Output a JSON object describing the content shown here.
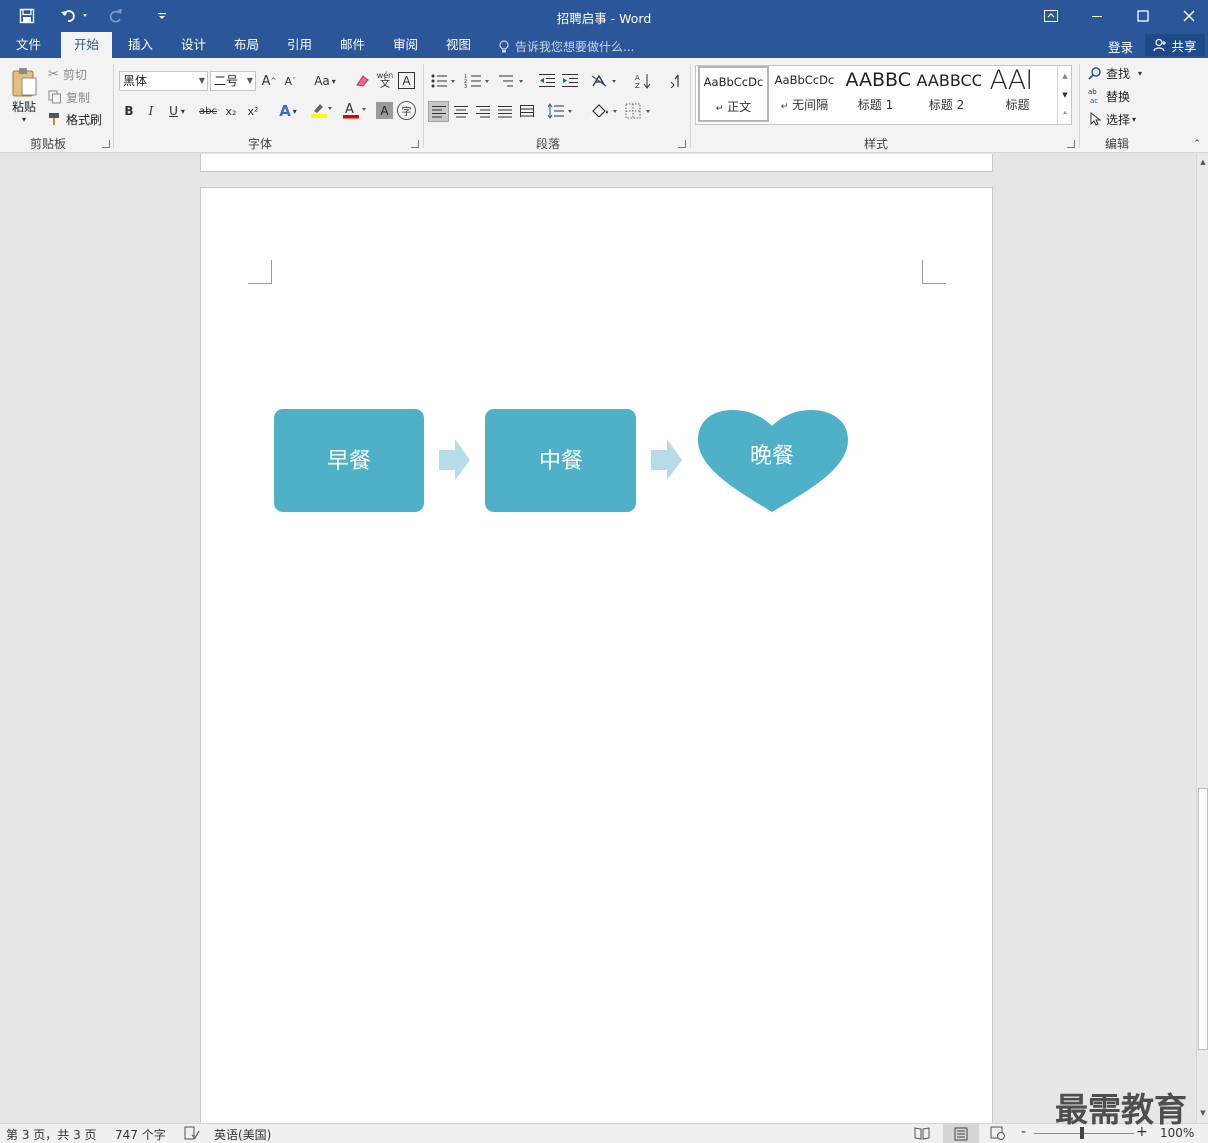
{
  "app": {
    "title": "招聘启事 - Word"
  },
  "tabs": [
    {
      "label": "文件"
    },
    {
      "label": "开始"
    },
    {
      "label": "插入"
    },
    {
      "label": "设计"
    },
    {
      "label": "布局"
    },
    {
      "label": "引用"
    },
    {
      "label": "邮件"
    },
    {
      "label": "审阅"
    },
    {
      "label": "视图"
    }
  ],
  "tell_me": {
    "placeholder": "告诉我您想要做什么..."
  },
  "account": {
    "login": "登录",
    "share": "共享"
  },
  "ribbon": {
    "clipboard": {
      "paste": "粘贴",
      "cut": "剪切",
      "copy": "复制",
      "format_painter": "格式刷",
      "label": "剪贴板"
    },
    "font": {
      "name": "黑体",
      "size": "二号",
      "grow": "A",
      "shrink": "A",
      "change_case": "Aa",
      "wen": "wén",
      "bold": "B",
      "italic": "I",
      "underline": "U",
      "strike": "abc",
      "subscript": "x₂",
      "superscript": "x²",
      "label": "字体"
    },
    "paragraph": {
      "label": "段落"
    },
    "styles": {
      "items": [
        {
          "preview": "AaBbCcDc",
          "name": "正文"
        },
        {
          "preview": "AaBbCcDc",
          "name": "无间隔"
        },
        {
          "preview": "AABBC",
          "name": "标题 1"
        },
        {
          "preview": "AABBCC",
          "name": "标题 2"
        },
        {
          "preview": "AAI",
          "name": "标题"
        }
      ],
      "label": "样式"
    },
    "editing": {
      "find": "查找",
      "replace": "替换",
      "select": "选择",
      "label": "编辑"
    }
  },
  "diagram": {
    "shapes": [
      {
        "label": "早餐",
        "shape": "rounded-rectangle"
      },
      {
        "label": "中餐",
        "shape": "rounded-rectangle"
      },
      {
        "label": "晚餐",
        "shape": "heart"
      }
    ],
    "fill_color": "#4fb1c8",
    "arrow_color": "#b7dce6"
  },
  "status": {
    "page": "第 3 页，共 3 页",
    "words": "747 个字",
    "language": "英语(美国)",
    "zoom": "100%"
  },
  "watermark": "最需教育"
}
